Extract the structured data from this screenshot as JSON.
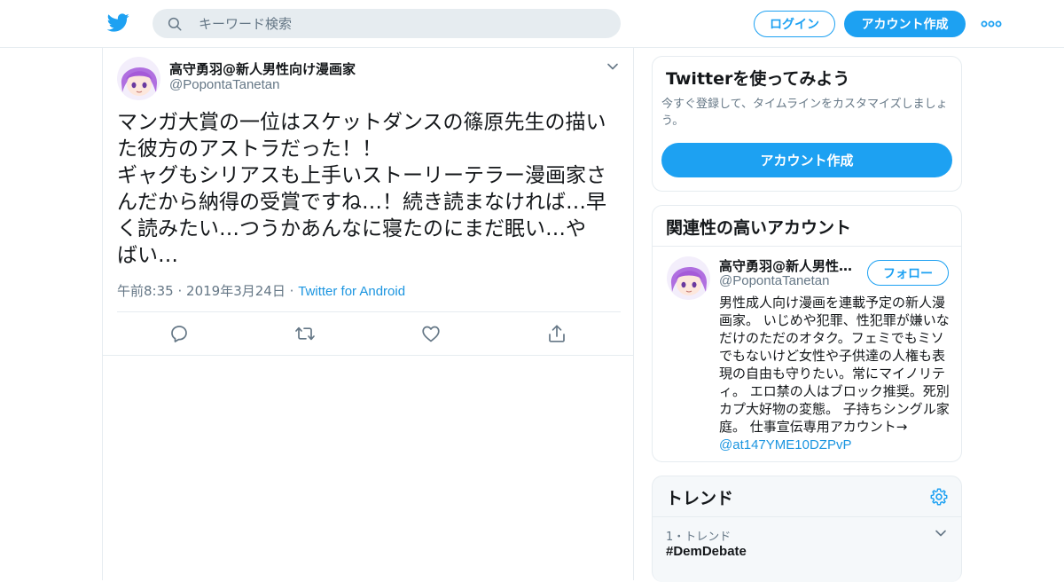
{
  "header": {
    "search_placeholder": "キーワード検索",
    "login_label": "ログイン",
    "signup_label": "アカウント作成",
    "icons": {
      "logo": "twitter-bird-icon",
      "search": "search-icon",
      "more": "more-dots-icon"
    }
  },
  "tweet": {
    "author_name": "高守勇羽@新人男性向け漫画家",
    "author_handle": "@PopontaTanetan",
    "text_lines": [
      "マンガ大賞の一位はスケットダンスの篠原先生の描い",
      "た彼方のアストラだった！！",
      "ギャグもシリアスも上手いストーリーテラー漫画家さ",
      "んだから納得の受賞ですね…！続き読まなければ…早",
      "く読みたい…つうかあんなに寝たのにまだ眠い…や",
      "ばい…"
    ],
    "time": "午前8:35",
    "date": "2019年3月24日",
    "separator": "·",
    "source": "Twitter for Android",
    "actions": [
      "reply-icon",
      "retweet-icon",
      "like-icon",
      "share-icon"
    ]
  },
  "try_twitter": {
    "title": "Twitterを使ってみよう",
    "subtitle": "今すぐ登録して、タイムラインをカスタマイズしましょう。",
    "button_label": "アカウント作成"
  },
  "relevant": {
    "title": "関連性の高いアカウント",
    "account": {
      "name": "高守勇羽@新人男性…",
      "handle": "@PopontaTanetan",
      "follow_label": "フォロー",
      "bio": "男性成人向け漫画を連載予定の新人漫画家。 いじめや犯罪、性犯罪が嫌いなだけのただのオタク。フェミでもミソでもないけど女性や子供達の人権も表現の自由も守りたい。常にマイノリティ。 エロ禁の人はブロック推奨。死別カプ大好物の変態。 子持ちシングル家庭。 仕事宣伝専用アカウント→",
      "bio_mention": "@at147YME10DZPvP"
    }
  },
  "trends": {
    "title": "トレンド",
    "items": [
      {
        "rank_label": "1・トレンド",
        "tag": "#DemDebate"
      }
    ]
  },
  "colors": {
    "brand_blue": "#1da1f2",
    "link_blue": "#1b95e0",
    "secondary_text": "#657786",
    "border": "#e6ecf0"
  }
}
